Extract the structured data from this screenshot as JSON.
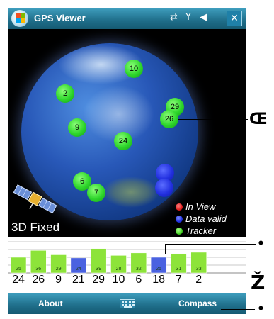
{
  "titlebar": {
    "title": "GPS Viewer",
    "icons": [
      "start-icon",
      "connectivity-icon",
      "signal-icon",
      "volume-icon"
    ],
    "close_label": "✕"
  },
  "sky_view": {
    "satellites": [
      {
        "prn": "10",
        "state": "tracker"
      },
      {
        "prn": "2",
        "state": "tracker"
      },
      {
        "prn": "29",
        "state": "tracker"
      },
      {
        "prn": "26",
        "state": "tracker"
      },
      {
        "prn": "9",
        "state": "tracker"
      },
      {
        "prn": "24",
        "state": "tracker"
      },
      {
        "prn": "6",
        "state": "tracker"
      },
      {
        "prn": "7",
        "state": "tracker"
      },
      {
        "prn": "",
        "state": "data-valid"
      },
      {
        "prn": "",
        "state": "data-valid"
      }
    ],
    "fix_status": "3D Fixed",
    "legend": [
      {
        "label": "In View",
        "color": "#e02020"
      },
      {
        "label": "Data valid",
        "color": "#2030e0"
      },
      {
        "label": "Tracker",
        "color": "#40d020"
      }
    ]
  },
  "signal_bars": {
    "prns": [
      "24",
      "26",
      "9",
      "21",
      "29",
      "10",
      "6",
      "18",
      "7",
      "2"
    ],
    "snr": [
      "25",
      "36",
      "29",
      "24",
      "39",
      "28",
      "32",
      "25",
      "31",
      "33"
    ],
    "colors": [
      "#8de33a",
      "#8de33a",
      "#8de33a",
      "#4a62e0",
      "#8de33a",
      "#8de33a",
      "#8de33a",
      "#4a62e0",
      "#8de33a",
      "#8de33a"
    ],
    "ymax": 50
  },
  "menubar": {
    "left_softkey": "About",
    "right_softkey": "Compass"
  },
  "callouts": {
    "c1": "Œ",
    "c2": "•",
    "c3": "Ž",
    "c4": "•"
  },
  "colors": {
    "title_bar": "#1f6e8a",
    "tracker": "#2ed62b",
    "data_valid": "#2230e0"
  }
}
